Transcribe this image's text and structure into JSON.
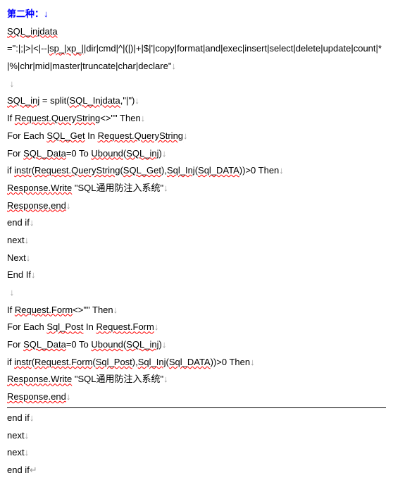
{
  "heading": "第二种：",
  "lines": {
    "l1a": "SQL_injdata",
    "l1b": "=\":|;|>|<|--|",
    "l1c": "sp_|xp_|",
    "l1d": "|dir|cmd|^|(|)|+|$|'|copy|format|and|exec|insert|select|delete|update|count|*|%|chr|mid|master|truncate|char|declare\"",
    "blank": " ",
    "l3a": "SQL_inj",
    "l3b": " = split(",
    "l3c": "SQL_Injdata",
    "l3d": ",\"|\")",
    "l4a": "If ",
    "l4b": "Request.QueryString",
    "l4c": "<>\"\" Then",
    "l5a": "For Each ",
    "l5b": "SQL_Get",
    "l5c": " In ",
    "l5d": "Request.QueryString",
    "l6a": "For ",
    "l6b": "SQL_Data",
    "l6c": "=0 To ",
    "l6d": "Ubound",
    "l6e": "(",
    "l6f": "SQL_inj",
    "l6g": ")",
    "l7a": "if ",
    "l7b": "instr",
    "l7c": "(",
    "l7d": "Request.QueryString",
    "l7e": "(",
    "l7f": "SQL_Get",
    "l7g": "),",
    "l7h": "Sql_Inj",
    "l7i": "(",
    "l7j": "Sql_DATA",
    "l7k": "))>0 Then",
    "l8a": "Response.Write",
    "l8b": " \"SQL通用防注入系统\"",
    "l9a": "Response.end",
    "l10": "end if",
    "l11": "next",
    "l12": "Next",
    "l13": "End If",
    "l15a": "If ",
    "l15b": "Request.Form",
    "l15c": "<>\"\" Then",
    "l16a": "For Each ",
    "l16b": "Sql_Post",
    "l16c": " In ",
    "l16d": "Request.Form",
    "l17a": "For ",
    "l17b": "SQL_Data",
    "l17c": "=0 To ",
    "l17d": "Ubound",
    "l17e": "(",
    "l17f": "SQL_inj",
    "l17g": ")",
    "l18a": "if ",
    "l18b": "instr",
    "l18c": "(",
    "l18d": "Request.Form",
    "l18e": "(",
    "l18f": "Sql_Post",
    "l18g": "),",
    "l18h": "Sql_Inj",
    "l18i": "(",
    "l18j": "Sql_DATA",
    "l18k": "))>0 Then",
    "l19a": "Response.Write",
    "l19b": " \"SQL通用防注入系统\"",
    "l20a": "Response.end",
    "l22": "end if",
    "l23": "next",
    "l24": "next",
    "l25": "end if"
  },
  "marks": {
    "down": "↓"
  }
}
